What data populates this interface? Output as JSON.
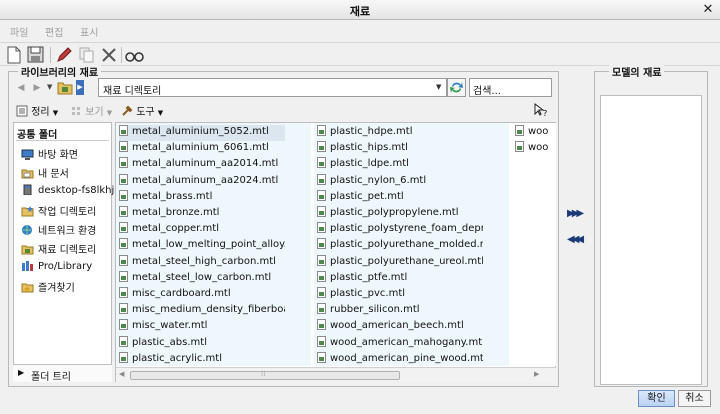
{
  "window": {
    "title": "재료",
    "close_glyph": "✕"
  },
  "menu": [
    "파일",
    "편집",
    "표시"
  ],
  "toolbar": {
    "icons": [
      "new-icon",
      "save-icon",
      "edit-icon",
      "copy-icon",
      "delete-icon",
      "preview-icon"
    ]
  },
  "library": {
    "group_title": "라이브러리의 재료",
    "path": "재료 디렉토리",
    "search_placeholder": "검색...",
    "organize_label": "정리",
    "view_label": "보기",
    "tools_label": "도구",
    "sidebar": {
      "header": "공통 폴더",
      "items": [
        {
          "label": "바탕 화면",
          "icon": "desktop-icon"
        },
        {
          "label": "내 문서",
          "icon": "my-documents-icon"
        },
        {
          "label": "desktop-fs8lkhj",
          "icon": "computer-icon"
        },
        {
          "label": "작업 디렉토리",
          "icon": "working-directory-icon"
        },
        {
          "label": "네트워크 환경",
          "icon": "network-icon"
        },
        {
          "label": "재료 디렉토리",
          "icon": "materials-folder-icon"
        },
        {
          "label": "Pro/Library",
          "icon": "library-icon"
        },
        {
          "label": "즐겨찾기",
          "icon": "favorites-icon"
        }
      ],
      "folder_tree": "폴더 트리"
    },
    "files": {
      "col1": [
        "metal_aluminium_5052.mtl",
        "metal_aluminium_6061.mtl",
        "metal_aluminum_aa2014.mtl",
        "metal_aluminum_aa2024.mtl",
        "metal_brass.mtl",
        "metal_bronze.mtl",
        "metal_copper.mtl",
        "metal_low_melting_point_alloy.mtl",
        "metal_steel_high_carbon.mtl",
        "metal_steel_low_carbon.mtl",
        "misc_cardboard.mtl",
        "misc_medium_density_fiberboard.mtl",
        "misc_water.mtl",
        "plastic_abs.mtl",
        "plastic_acrylic.mtl"
      ],
      "col2": [
        "plastic_hdpe.mtl",
        "plastic_hips.mtl",
        "plastic_ldpe.mtl",
        "plastic_nylon_6.mtl",
        "plastic_pet.mtl",
        "plastic_polypropylene.mtl",
        "plastic_polystyrene_foam_depron.mtl",
        "plastic_polyurethane_molded.mtl",
        "plastic_polyurethane_ureol.mtl",
        "plastic_ptfe.mtl",
        "plastic_pvc.mtl",
        "rubber_silicon.mtl",
        "wood_american_beech.mtl",
        "wood_american_mahogany.mtl",
        "wood_american_pine_wood.mtl"
      ],
      "col3": [
        "woo",
        "woo"
      ]
    }
  },
  "model": {
    "group_title": "모델의 재료"
  },
  "actions": {
    "add": "▶▶▶",
    "remove": "◀◀◀"
  },
  "buttons": {
    "ok": "확인",
    "cancel": "취소"
  }
}
